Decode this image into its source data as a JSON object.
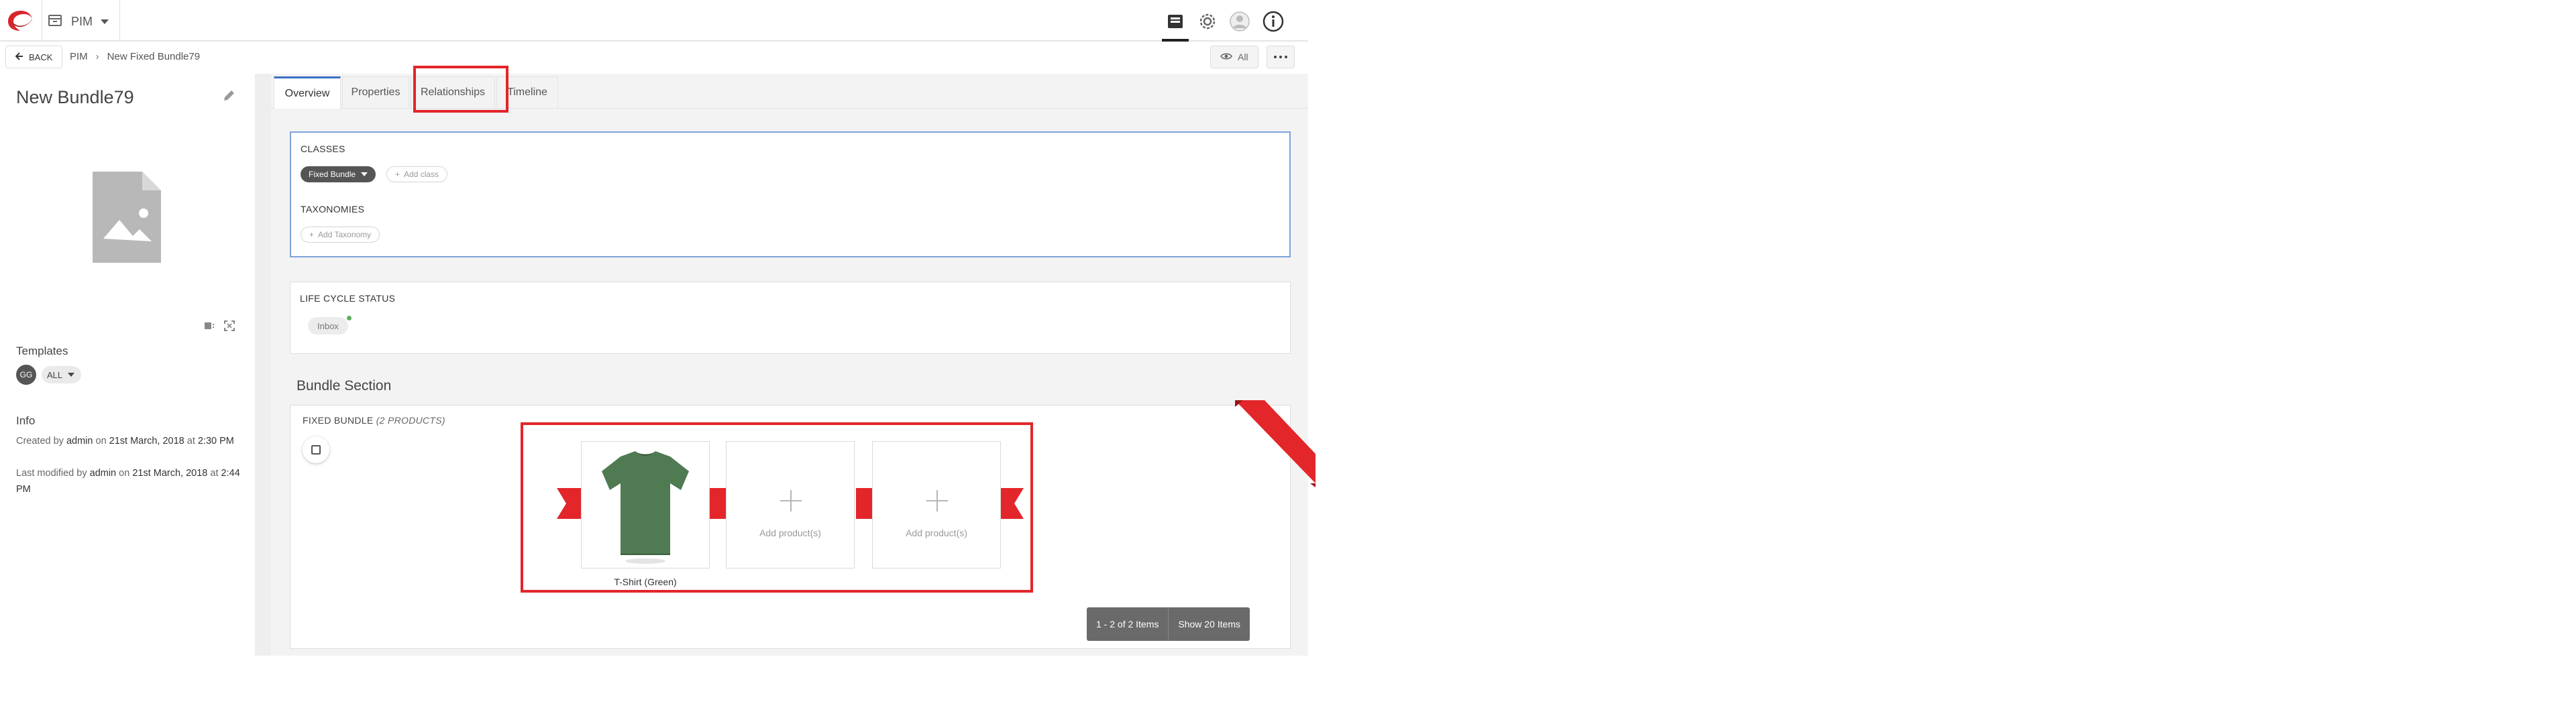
{
  "header": {
    "app_name": "PIM"
  },
  "breadcrumb": {
    "back_label": "BACK",
    "items": [
      "PIM",
      "New Fixed Bundle79"
    ],
    "view_label": "All"
  },
  "left_panel": {
    "title": "New Bundle79",
    "templates_label": "Templates",
    "templates_avatar": "GG",
    "templates_value": "ALL",
    "info_label": "Info",
    "created_prefix": "Created by",
    "created_user": "admin",
    "created_on": "on",
    "created_date": "21st March, 2018",
    "created_at": "at",
    "created_time": "2:30 PM",
    "modified_prefix": "Last modified by",
    "modified_user": "admin",
    "modified_on": "on",
    "modified_date": "21st March, 2018",
    "modified_at": "at",
    "modified_time": "2:44 PM"
  },
  "tabs": [
    {
      "label": "Overview"
    },
    {
      "label": "Properties"
    },
    {
      "label": "Relationships"
    },
    {
      "label": "Timeline"
    }
  ],
  "classes_card": {
    "classes_title": "CLASSES",
    "class_chip": "Fixed Bundle",
    "add_class": "Add class",
    "taxonomies_title": "TAXONOMIES",
    "add_taxonomy": "Add Taxonomy"
  },
  "lifecycle_card": {
    "title": "LIFE CYCLE STATUS",
    "status": "Inbox"
  },
  "bundle": {
    "heading": "Bundle Section",
    "label": "FIXED BUNDLE",
    "count_label": "(2 PRODUCTS)",
    "product_caption": "T-Shirt (Green)",
    "add_product_1": "Add product(s)",
    "add_product_2": "Add product(s)",
    "pager_count": "1 - 2 of 2 Items",
    "pager_show": "Show 20 Items"
  },
  "colors": {
    "accent_red": "#e2262a",
    "active_tab_border": "#3b6ec8",
    "tshirt_green": "#4f7a52"
  }
}
